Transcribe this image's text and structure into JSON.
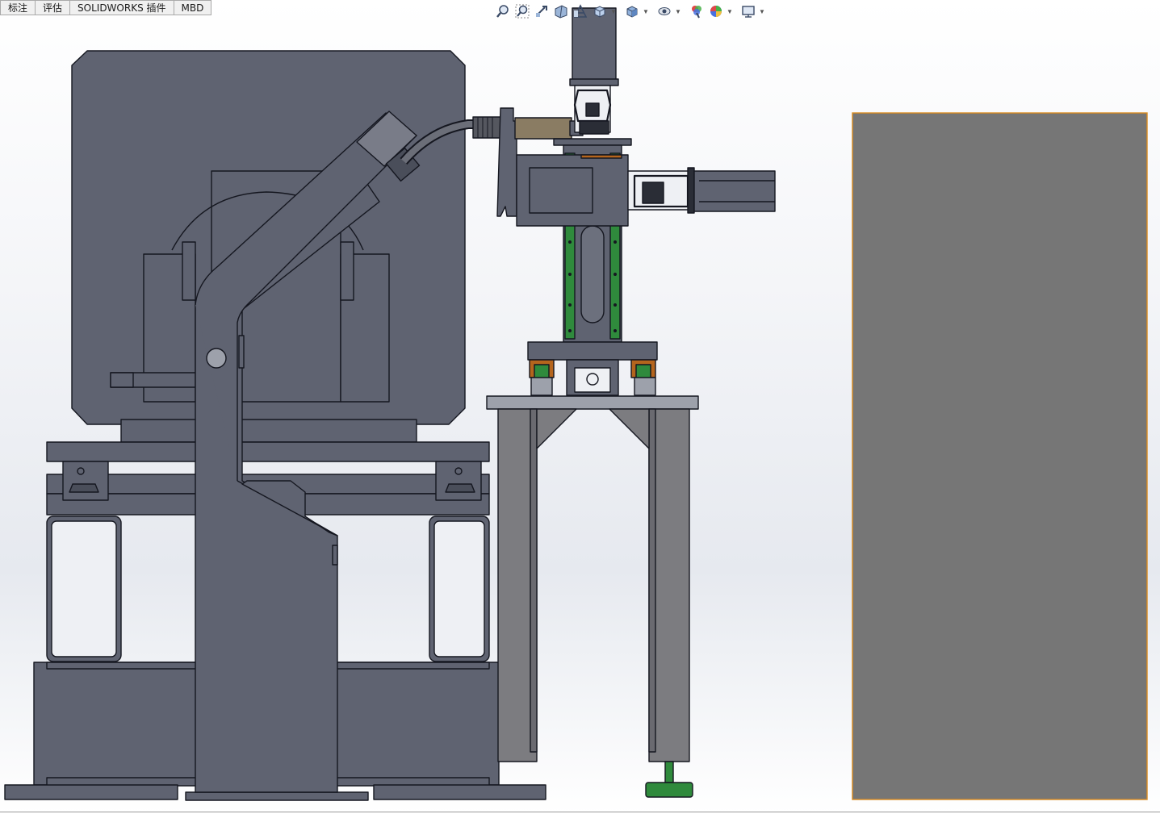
{
  "tabs": [
    {
      "label": "标注"
    },
    {
      "label": "评估"
    },
    {
      "label": "SOLIDWORKS 插件"
    },
    {
      "label": "MBD"
    }
  ],
  "toolbar": {
    "icons": [
      "zoom-to-fit-icon",
      "zoom-to-area-icon",
      "previous-view-icon",
      "section-view-icon",
      "dynamic-annotation-icon",
      "view-orientation-icon",
      "display-style-icon",
      "hide-show-items-icon",
      "edit-appearance-icon",
      "apply-scene-icon",
      "view-settings-icon"
    ]
  },
  "colors": {
    "machine_body": "#5f6371",
    "machine_outline": "#151720",
    "stand_frame": "#7c7c80",
    "linear_guide": "#2f8a3c",
    "panel_fill": "#767676",
    "panel_border": "#d98a1e",
    "copper": "#b5651d"
  }
}
